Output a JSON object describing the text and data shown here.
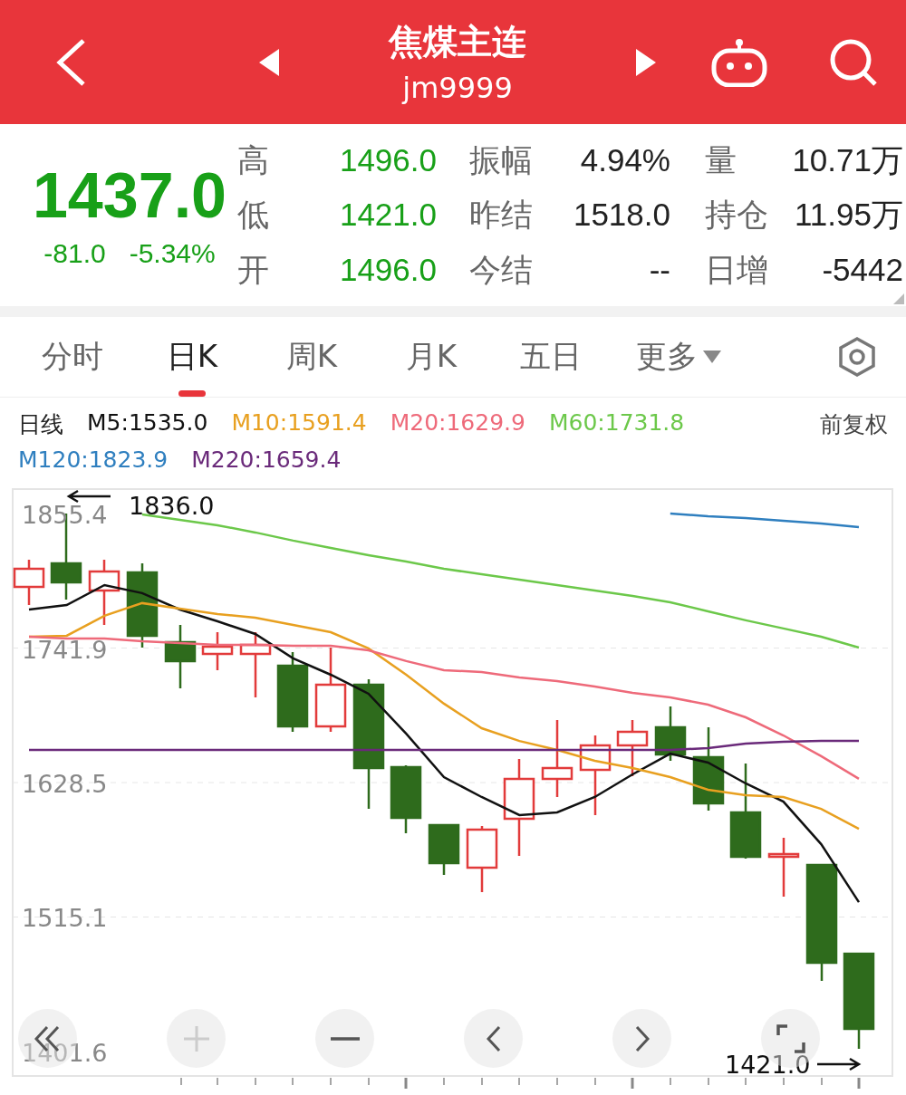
{
  "header": {
    "title": "焦煤主连",
    "code": "jm9999"
  },
  "quote": {
    "price": "1437.0",
    "change": "-81.0",
    "change_pct": "-5.34%",
    "stats": [
      {
        "label": "高",
        "value": "1496.0",
        "color": "#18a018"
      },
      {
        "label": "振幅",
        "value": "4.94%",
        "color": "#222222"
      },
      {
        "label": "量",
        "value": "10.71万",
        "color": "#222222"
      },
      {
        "label": "低",
        "value": "1421.0",
        "color": "#18a018"
      },
      {
        "label": "昨结",
        "value": "1518.0",
        "color": "#222222"
      },
      {
        "label": "持仓",
        "value": "11.95万",
        "color": "#222222"
      },
      {
        "label": "开",
        "value": "1496.0",
        "color": "#18a018"
      },
      {
        "label": "今结",
        "value": "--",
        "color": "#222222"
      },
      {
        "label": "日增",
        "value": "-5442",
        "color": "#222222"
      }
    ]
  },
  "tabs": [
    {
      "label": "分时",
      "selected": false
    },
    {
      "label": "日K",
      "selected": true
    },
    {
      "label": "周K",
      "selected": false
    },
    {
      "label": "月K",
      "selected": false
    },
    {
      "label": "五日",
      "selected": false
    },
    {
      "label": "更多",
      "selected": false,
      "kind": "dropdown"
    }
  ],
  "legend": {
    "period": "日线",
    "adjust": "前复权",
    "items": [
      {
        "label": "M5:1535.0",
        "color": "#111111"
      },
      {
        "label": "M10:1591.4",
        "color": "#e8a020"
      },
      {
        "label": "M20:1629.9",
        "color": "#ee6a7a"
      },
      {
        "label": "M60:1731.8",
        "color": "#6cc84a"
      },
      {
        "label": "M120:1823.9",
        "color": "#2f7fbf"
      },
      {
        "label": "M220:1659.4",
        "color": "#6a2a7a"
      }
    ]
  },
  "chart": {
    "high_mark": "1836.0",
    "low_mark": "1421.0",
    "chart_data": {
      "type": "line",
      "grid": true,
      "ylim": [
        1381,
        1876
      ],
      "yticks": [
        1855.4,
        1741.9,
        1628.5,
        1515.1,
        1401.6
      ],
      "series": [
        {
          "color": "#111111",
          "values": [
            1774.4,
            1778.2,
            1795.0,
            1788.2,
            1774.4,
            1764.5,
            1753.8,
            1733.2,
            1719.4,
            1703.4,
            1669.7,
            1633.1,
            1616.3,
            1601.0,
            1603.3,
            1616.3,
            1635.4,
            1652.9,
            1645.3,
            1627.7,
            1612.4,
            1576.5,
            1527.6
          ]
        },
        {
          "color": "#e8a020",
          "values": [
            1751.5,
            1752.3,
            1769.1,
            1779.8,
            1775.2,
            1770.6,
            1767.5,
            1761.4,
            1755.3,
            1741.6,
            1719.4,
            1695.0,
            1674.3,
            1663.6,
            1656.0,
            1646.8,
            1640.7,
            1633.1,
            1622.4,
            1617.8,
            1616.3,
            1606.3,
            1589.5
          ]
        },
        {
          "color": "#ee6a7a",
          "values": [
            1751.5,
            1750.0,
            1750.0,
            1747.7,
            1746.1,
            1744.6,
            1744.6,
            1743.9,
            1743.9,
            1740.0,
            1730.9,
            1723.2,
            1721.7,
            1717.1,
            1714.1,
            1709.5,
            1704.1,
            1700.3,
            1694.2,
            1683.5,
            1668.2,
            1650.7,
            1631.6
          ]
        },
        {
          "color": "#6cc84a",
          "values": [
            null,
            null,
            null,
            1854.6,
            1850.1,
            1845.5,
            1839.4,
            1832.5,
            1826.4,
            1820.3,
            1814.9,
            1808.8,
            1804.2,
            1799.6,
            1795.0,
            1790.5,
            1785.9,
            1780.5,
            1772.9,
            1765.3,
            1758.4,
            1751.5,
            1742.3
          ]
        },
        {
          "color": "#2f7fbf",
          "values": [
            null,
            null,
            null,
            null,
            null,
            null,
            null,
            null,
            null,
            null,
            null,
            null,
            null,
            null,
            null,
            null,
            null,
            1855.4,
            1853.1,
            1851.6,
            1849.3,
            1847.0,
            1843.9
          ]
        },
        {
          "color": "#6a2a7a",
          "values": [
            1656.0,
            1656.0,
            1656.0,
            1656.0,
            1656.0,
            1656.0,
            1656.0,
            1656.0,
            1656.0,
            1656.0,
            1656.0,
            1656.0,
            1656.0,
            1656.0,
            1656.0,
            1656.0,
            1656.0,
            1656.0,
            1657.5,
            1661.3,
            1662.9,
            1663.6,
            1663.6
          ]
        }
      ]
    }
  }
}
